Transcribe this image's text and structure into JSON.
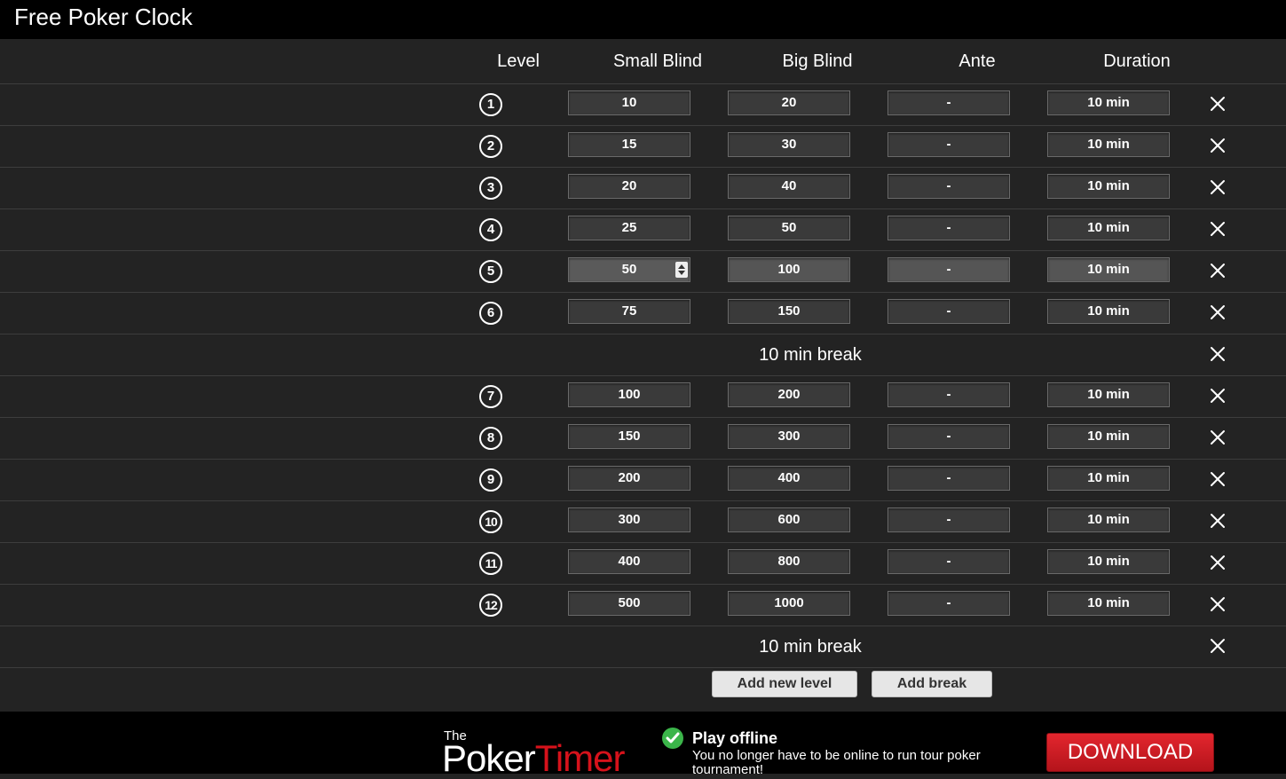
{
  "app": {
    "title": "Free Poker Clock"
  },
  "columns": {
    "level": "Level",
    "small_blind": "Small Blind",
    "big_blind": "Big Blind",
    "ante": "Ante",
    "duration": "Duration"
  },
  "rows": [
    {
      "type": "level",
      "level": "1",
      "small_blind": "10",
      "big_blind": "20",
      "ante": "-",
      "duration": "10 min"
    },
    {
      "type": "level",
      "level": "2",
      "small_blind": "15",
      "big_blind": "30",
      "ante": "-",
      "duration": "10 min"
    },
    {
      "type": "level",
      "level": "3",
      "small_blind": "20",
      "big_blind": "40",
      "ante": "-",
      "duration": "10 min"
    },
    {
      "type": "level",
      "level": "4",
      "small_blind": "25",
      "big_blind": "50",
      "ante": "-",
      "duration": "10 min"
    },
    {
      "type": "level",
      "level": "5",
      "small_blind": "50",
      "big_blind": "100",
      "ante": "-",
      "duration": "10 min",
      "focused": true
    },
    {
      "type": "level",
      "level": "6",
      "small_blind": "75",
      "big_blind": "150",
      "ante": "-",
      "duration": "10 min"
    },
    {
      "type": "break",
      "label": "10 min break"
    },
    {
      "type": "level",
      "level": "7",
      "small_blind": "100",
      "big_blind": "200",
      "ante": "-",
      "duration": "10 min"
    },
    {
      "type": "level",
      "level": "8",
      "small_blind": "150",
      "big_blind": "300",
      "ante": "-",
      "duration": "10 min"
    },
    {
      "type": "level",
      "level": "9",
      "small_blind": "200",
      "big_blind": "400",
      "ante": "-",
      "duration": "10 min"
    },
    {
      "type": "level",
      "level": "10",
      "small_blind": "300",
      "big_blind": "600",
      "ante": "-",
      "duration": "10 min"
    },
    {
      "type": "level",
      "level": "11",
      "small_blind": "400",
      "big_blind": "800",
      "ante": "-",
      "duration": "10 min"
    },
    {
      "type": "level",
      "level": "12",
      "small_blind": "500",
      "big_blind": "1000",
      "ante": "-",
      "duration": "10 min"
    },
    {
      "type": "break",
      "label": "10 min break"
    }
  ],
  "actions": {
    "add_level": "Add new level",
    "add_break": "Add break"
  },
  "footer": {
    "logo_the": "The",
    "logo_poker": "Poker",
    "logo_timer": "Timer",
    "promo_title": "Play offline",
    "promo_text": "You no longer have to be online to run tour poker tournament!",
    "download": "DOWNLOAD"
  },
  "colors": {
    "background": "#232323",
    "topbar": "#000000",
    "field": "#3a3a3a",
    "accent_red": "#d6121b",
    "check_green": "#3bb54a"
  },
  "icons": {
    "delete": "close-icon",
    "check": "check-icon",
    "spinner": "spinner-icon"
  }
}
